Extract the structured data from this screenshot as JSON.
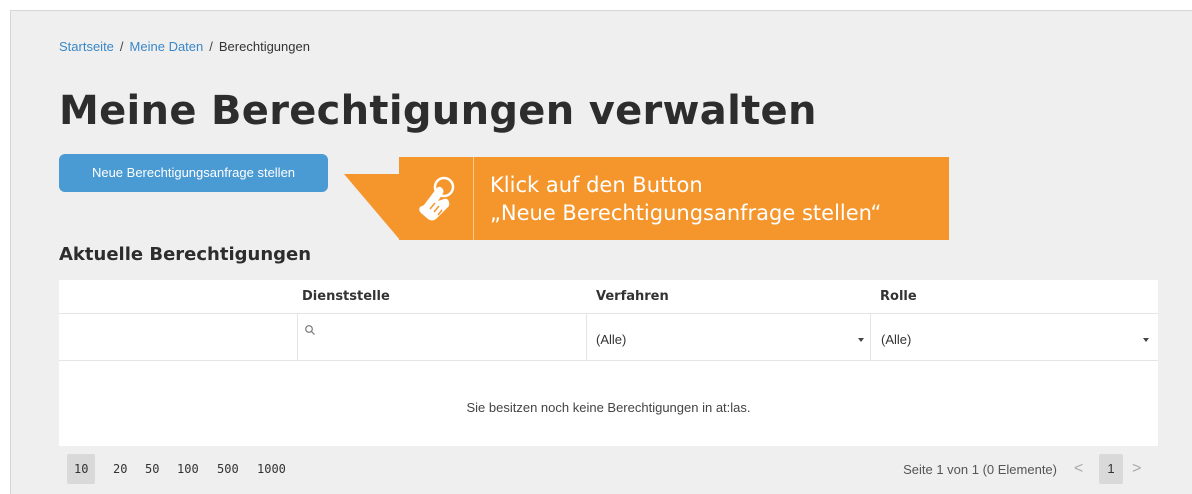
{
  "breadcrumb": {
    "items": [
      "Startseite",
      "Meine Daten",
      "Berechtigungen"
    ],
    "separator": "/"
  },
  "page_title": "Meine Berechtigungen verwalten",
  "primary_button": {
    "label": "Neue Berechtigungsanfrage stellen"
  },
  "callout": {
    "line1": "Klick auf den Button",
    "line2": "„Neue Berechtigungsanfrage stellen“",
    "icon": "hand-pointer-icon",
    "color": "#f5962d"
  },
  "section_title": "Aktuelle Berechtigungen",
  "table": {
    "columns": [
      "",
      "Dienststelle",
      "Verfahren",
      "Rolle"
    ],
    "filters": {
      "dienststelle_placeholder": "",
      "verfahren_value": "(Alle)",
      "rolle_value": "(Alle)"
    },
    "empty_message": "Sie besitzen noch keine Berechtigungen in at:las."
  },
  "pager": {
    "page_sizes": [
      "10",
      "20",
      "50",
      "100",
      "500",
      "1000"
    ],
    "active_page_size": "10",
    "info": "Seite 1 von 1 (0 Elemente)",
    "prev": "<",
    "next": ">",
    "current_page": "1"
  },
  "colors": {
    "accent": "#4a9ad4",
    "link": "#3a87c8",
    "callout": "#f5962d",
    "background": "#efefef"
  }
}
